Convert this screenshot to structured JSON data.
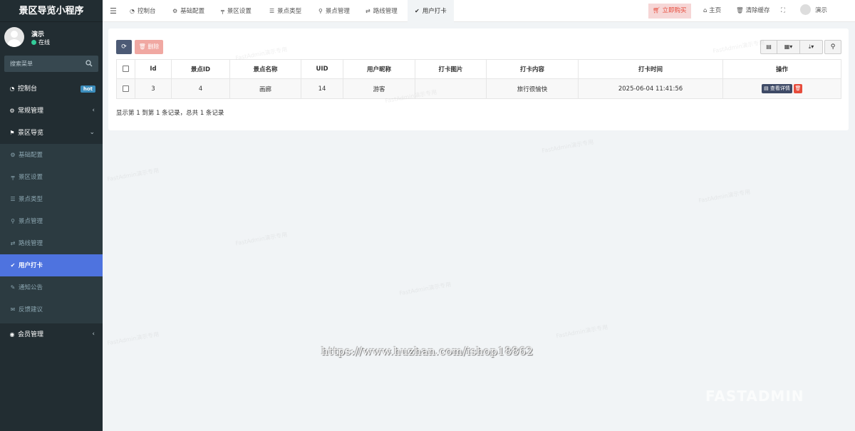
{
  "app": {
    "title": "景区导览小程序"
  },
  "user": {
    "name": "演示",
    "status": "在线"
  },
  "sidebar": {
    "search_placeholder": "搜索菜单",
    "items": [
      {
        "label": "控制台",
        "icon": "dashboard-icon",
        "badge": "hot"
      },
      {
        "label": "常规管理",
        "icon": "cogs-icon"
      },
      {
        "label": "景区导览",
        "icon": "flag-icon"
      },
      {
        "label": "基础配置",
        "icon": "gear-icon"
      },
      {
        "label": "景区设置",
        "icon": "signpost-icon"
      },
      {
        "label": "景点类型",
        "icon": "list-icon"
      },
      {
        "label": "景点管理",
        "icon": "map-marker-icon"
      },
      {
        "label": "路线管理",
        "icon": "retweet-icon"
      },
      {
        "label": "用户打卡",
        "icon": "check-icon"
      },
      {
        "label": "通知公告",
        "icon": "edit-icon"
      },
      {
        "label": "反馈建议",
        "icon": "envelope-icon"
      },
      {
        "label": "会员管理",
        "icon": "user-circle-icon"
      }
    ]
  },
  "topbar": {
    "tabs": [
      {
        "label": "控制台"
      },
      {
        "label": "基础配置"
      },
      {
        "label": "景区设置"
      },
      {
        "label": "景点类型"
      },
      {
        "label": "景点管理"
      },
      {
        "label": "路线管理"
      },
      {
        "label": "用户打卡"
      }
    ],
    "buy_label": "立即购买",
    "home_label": "主页",
    "clear_cache_label": "清除缓存",
    "user_label": "演示"
  },
  "toolbar": {
    "delete_label": "删除"
  },
  "table": {
    "columns": [
      "Id",
      "景点ID",
      "景点名称",
      "UID",
      "用户昵称",
      "打卡图片",
      "打卡内容",
      "打卡时间",
      "操作"
    ],
    "rows": [
      {
        "id": "3",
        "spot_id": "4",
        "spot_name": "画廊",
        "uid": "14",
        "nickname": "游客",
        "image": "",
        "content": "旅行很愉快",
        "time": "2025-06-04 11:41:56"
      }
    ],
    "detail_label": "查看详情"
  },
  "pager": {
    "summary": "显示第 1 到第 1 条记录，总共 1 条记录"
  },
  "watermark": {
    "url": "https://www.huzhan.com/ishop18862",
    "text": "FastAdmin演示专用",
    "logo": "FASTADMIN"
  }
}
